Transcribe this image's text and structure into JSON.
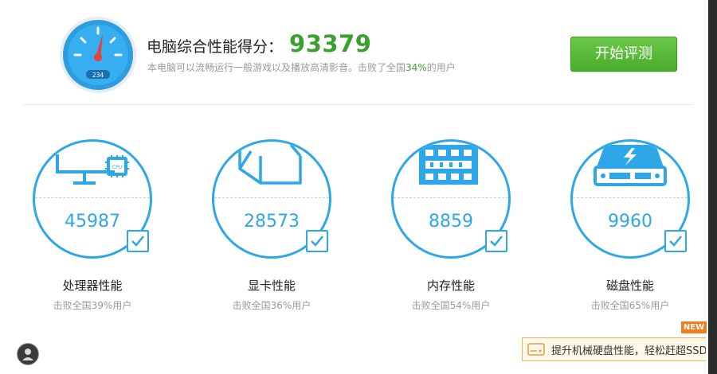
{
  "header": {
    "score_label": "电脑综合性能得分：",
    "score_value": "93379",
    "desc_prefix": "本电脑可以流畅运行一般游戏以及播放高清影音。击败了全国",
    "desc_percent": "34%",
    "desc_suffix": "的用户",
    "gauge_display": "234",
    "start_button": "开始评测"
  },
  "cards": [
    {
      "title": "处理器性能",
      "score": "45987",
      "subtitle": "击败全国39%用户",
      "icon": "monitor-cpu-icon",
      "icon_text": "CPU"
    },
    {
      "title": "显卡性能",
      "score": "28573",
      "subtitle": "击败全国36%用户",
      "icon": "graphics-card-icon"
    },
    {
      "title": "内存性能",
      "score": "8859",
      "subtitle": "击败全国54%用户",
      "icon": "memory-module-icon"
    },
    {
      "title": "磁盘性能",
      "score": "9960",
      "subtitle": "击败全国65%用户",
      "icon": "hard-disk-icon"
    }
  ],
  "promo": {
    "text": "提升机械硬盘性能，轻松赶超SSD",
    "badge": "NEW"
  },
  "colors": {
    "accent_blue": "#2ea7e8",
    "score_green": "#3aa12e",
    "button_green": "#49ad2a",
    "badge_orange": "#f07d1e"
  }
}
